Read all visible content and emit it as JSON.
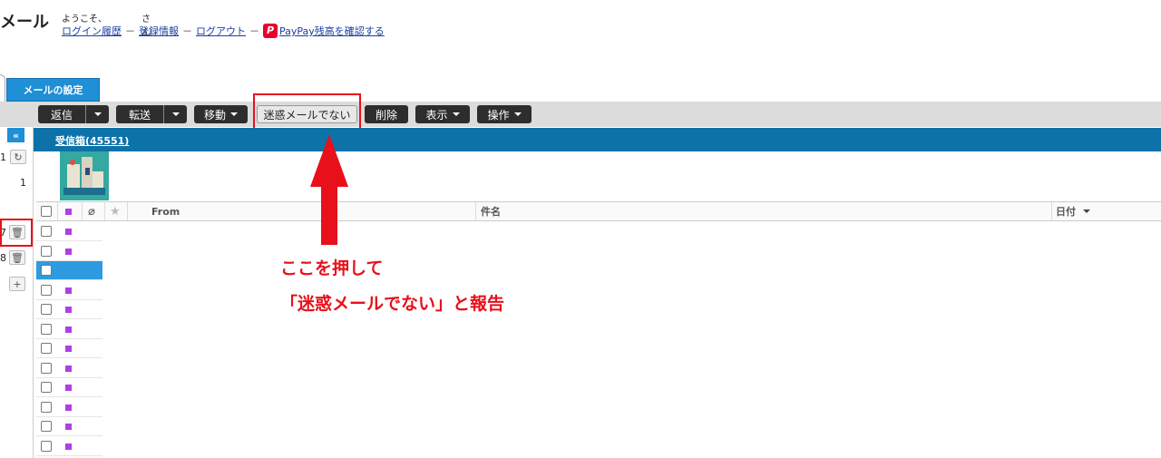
{
  "header": {
    "app_title": "メール",
    "welcome": "ようこそ、",
    "san": "さん",
    "links": {
      "login_history": "ログイン履歴",
      "account_info": "登録情報",
      "logout": "ログアウト",
      "paypay": "PayPay残高を確認する"
    },
    "separator": "－"
  },
  "settings_tab": "メールの設定",
  "toolbar": {
    "reply": "返信",
    "forward": "転送",
    "move": "移動",
    "not_spam": "迷惑メールでない",
    "delete": "削除",
    "view": "表示",
    "actions": "操作"
  },
  "sidebar": {
    "collapse_icon": "double-chevron-left",
    "items": [
      {
        "num": "1",
        "button": "refresh-icon"
      },
      {
        "num": "1"
      },
      {
        "num": "7",
        "button": "trash-icon"
      },
      {
        "num": "8",
        "button": "trash-icon"
      }
    ],
    "add": "+"
  },
  "folder": {
    "name": "受信箱(45551)"
  },
  "table": {
    "columns": [
      "From",
      "件名",
      "日付"
    ],
    "rows": [
      {
        "dot": true,
        "selected": false
      },
      {
        "dot": true,
        "selected": false
      },
      {
        "dot": false,
        "selected": true
      },
      {
        "dot": true,
        "selected": false
      },
      {
        "dot": true,
        "selected": false
      },
      {
        "dot": true,
        "selected": false
      },
      {
        "dot": true,
        "selected": false
      },
      {
        "dot": true,
        "selected": false
      },
      {
        "dot": true,
        "selected": false
      },
      {
        "dot": true,
        "selected": false
      },
      {
        "dot": true,
        "selected": false
      },
      {
        "dot": true,
        "selected": false
      }
    ]
  },
  "annotation": {
    "line1": "ここを押して",
    "line2": "「迷惑メールでない」と報告"
  },
  "colors": {
    "accent": "#1f8fd6",
    "folder_bar": "#0c72a8",
    "annotation": "#e8101a",
    "unread_dot": "#b03ee8"
  }
}
